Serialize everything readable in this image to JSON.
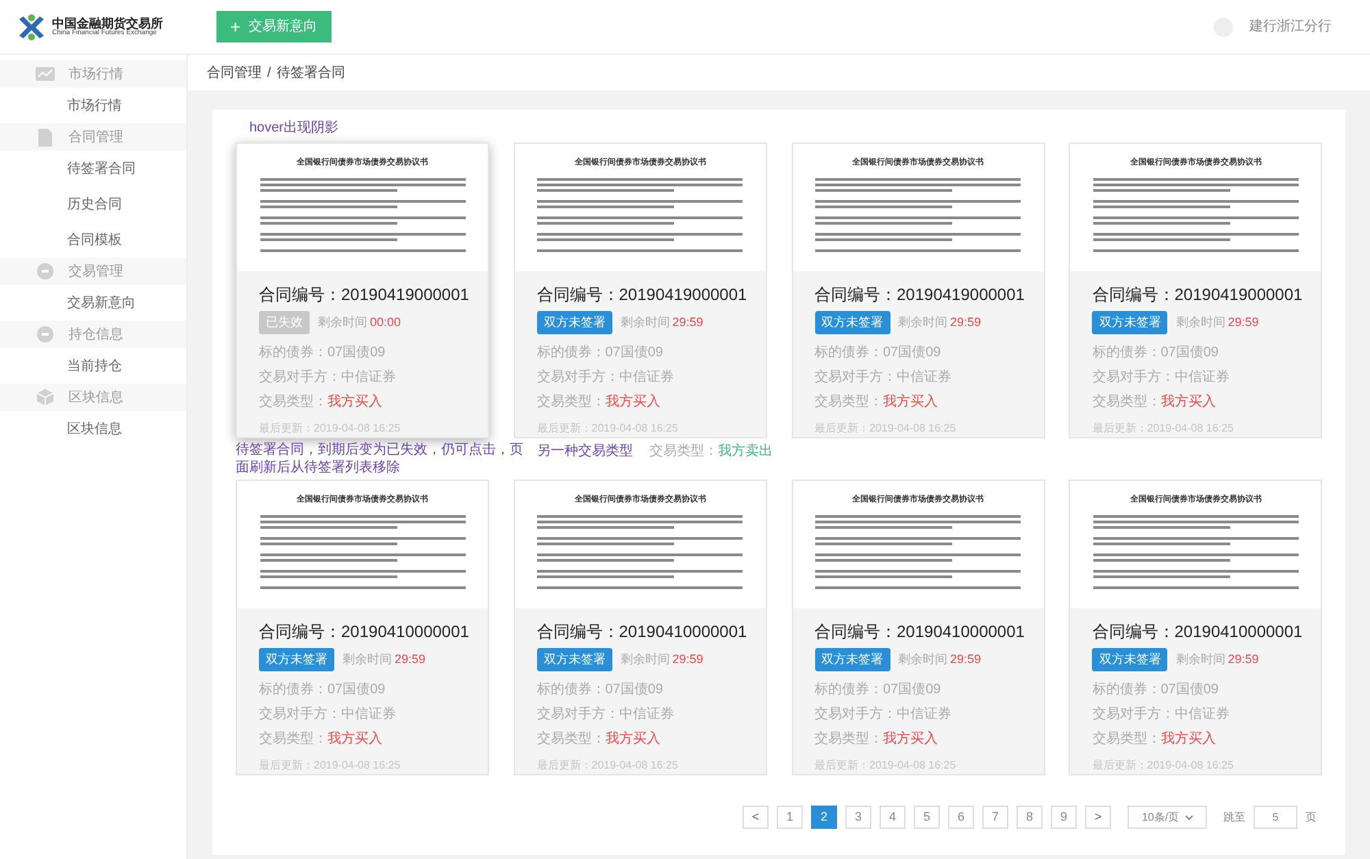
{
  "header": {
    "logo_cn": "中国金融期货交易所",
    "logo_en": "China Financial Futures Exchange",
    "new_button": {
      "icon": "+",
      "label": "交易新意向"
    },
    "user": "建行浙江分行"
  },
  "sidebar": [
    {
      "label": "市场行情",
      "kind": "chart",
      "children": [
        {
          "label": "市场行情"
        }
      ]
    },
    {
      "label": "合同管理",
      "kind": "file",
      "children": [
        {
          "label": "待签署合同"
        },
        {
          "label": "历史合同"
        },
        {
          "label": "合同模板"
        }
      ]
    },
    {
      "label": "交易管理",
      "kind": "circle",
      "children": [
        {
          "label": "交易新意向"
        }
      ]
    },
    {
      "label": "持仓信息",
      "kind": "circle",
      "children": [
        {
          "label": "当前持仓"
        }
      ]
    },
    {
      "label": "区块信息",
      "kind": "cube",
      "children": [
        {
          "label": "区块信息"
        }
      ]
    }
  ],
  "breadcrumb": [
    "合同管理",
    "/",
    "待签署合同"
  ],
  "top_note": "hover出现阴影",
  "cards": [
    {
      "doc_title": "全国银行间债券市场债券交易协议书",
      "contract_label": "合同编号：",
      "contract_no": "20190419000001",
      "status": {
        "kind": "expired",
        "label": "已失效"
      },
      "remaining_label": "剩余时间",
      "remaining": "00:00",
      "bond": "标的债券：07国债09",
      "counterparty": "交易对手方：中信证券",
      "type_label": "交易类型：",
      "type_value": "我方买入",
      "updated": "最后更新：2019-04-08 16:25",
      "hovered": true
    },
    {
      "doc_title": "全国银行间债券市场债券交易协议书",
      "contract_label": "合同编号：",
      "contract_no": "20190419000001",
      "status": {
        "kind": "pending",
        "label": "双方未签署"
      },
      "remaining_label": "剩余时间",
      "remaining": "29:59",
      "bond": "标的债券：07国债09",
      "counterparty": "交易对手方：中信证券",
      "type_label": "交易类型：",
      "type_value": "我方买入",
      "updated": "最后更新：2019-04-08 16:25",
      "hovered": false
    },
    {
      "doc_title": "全国银行间债券市场债券交易协议书",
      "contract_label": "合同编号：",
      "contract_no": "20190419000001",
      "status": {
        "kind": "pending",
        "label": "双方未签署"
      },
      "remaining_label": "剩余时间",
      "remaining": "29:59",
      "bond": "标的债券：07国债09",
      "counterparty": "交易对手方：中信证券",
      "type_label": "交易类型：",
      "type_value": "我方买入",
      "updated": "最后更新：2019-04-08 16:25",
      "hovered": false
    },
    {
      "doc_title": "全国银行间债券市场债券交易协议书",
      "contract_label": "合同编号：",
      "contract_no": "20190419000001",
      "status": {
        "kind": "pending",
        "label": "双方未签署"
      },
      "remaining_label": "剩余时间",
      "remaining": "29:59",
      "bond": "标的债券：07国债09",
      "counterparty": "交易对手方：中信证券",
      "type_label": "交易类型：",
      "type_value": "我方买入",
      "updated": "最后更新：2019-04-08 16:25",
      "hovered": false
    },
    {
      "doc_title": "全国银行间债券市场债券交易协议书",
      "contract_label": "合同编号：",
      "contract_no": "20190410000001",
      "status": {
        "kind": "pending",
        "label": "双方未签署"
      },
      "remaining_label": "剩余时间",
      "remaining": "29:59",
      "bond": "标的债券：07国债09",
      "counterparty": "交易对手方：中信证券",
      "type_label": "交易类型：",
      "type_value": "我方买入",
      "updated": "最后更新：2019-04-08 16:25",
      "hovered": false
    },
    {
      "doc_title": "全国银行间债券市场债券交易协议书",
      "contract_label": "合同编号：",
      "contract_no": "20190410000001",
      "status": {
        "kind": "pending",
        "label": "双方未签署"
      },
      "remaining_label": "剩余时间",
      "remaining": "29:59",
      "bond": "标的债券：07国债09",
      "counterparty": "交易对手方：中信证券",
      "type_label": "交易类型：",
      "type_value": "我方买入",
      "updated": "最后更新：2019-04-08 16:25",
      "hovered": false
    },
    {
      "doc_title": "全国银行间债券市场债券交易协议书",
      "contract_label": "合同编号：",
      "contract_no": "20190410000001",
      "status": {
        "kind": "pending",
        "label": "双方未签署"
      },
      "remaining_label": "剩余时间",
      "remaining": "29:59",
      "bond": "标的债券：07国债09",
      "counterparty": "交易对手方：中信证券",
      "type_label": "交易类型：",
      "type_value": "我方买入",
      "updated": "最后更新：2019-04-08 16:25",
      "hovered": false
    },
    {
      "doc_title": "全国银行间债券市场债券交易协议书",
      "contract_label": "合同编号：",
      "contract_no": "20190410000001",
      "status": {
        "kind": "pending",
        "label": "双方未签署"
      },
      "remaining_label": "剩余时间",
      "remaining": "29:59",
      "bond": "标的债券：07国债09",
      "counterparty": "交易对手方：中信证券",
      "type_label": "交易类型：",
      "type_value": "我方买入",
      "updated": "最后更新：2019-04-08 16:25",
      "hovered": false
    }
  ],
  "notes": {
    "expired_note": "待签署合同，到期后变为已失效，仍可点击，页面刷新后从待签署列表移除",
    "other_type_note": "另一种交易类型",
    "other_type_label": "交易类型：",
    "other_type_value": "我方卖出"
  },
  "pagination": {
    "prev": "<",
    "pages": [
      {
        "label": "1",
        "selected": false
      },
      {
        "label": "2",
        "selected": true
      },
      {
        "label": "3",
        "selected": false
      },
      {
        "label": "4",
        "selected": false
      },
      {
        "label": "5",
        "selected": false
      },
      {
        "label": "6",
        "selected": false
      },
      {
        "label": "7",
        "selected": false
      },
      {
        "label": "8",
        "selected": false
      },
      {
        "label": "9",
        "selected": false
      }
    ],
    "next": ">",
    "page_size": "10条/页",
    "jump_label": "跳至",
    "jump_value": "5",
    "page_unit": "页"
  }
}
